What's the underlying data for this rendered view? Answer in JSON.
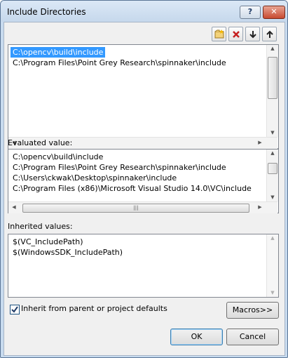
{
  "window": {
    "title": "Include Directories",
    "help_label": "?",
    "close_label": "✕"
  },
  "toolbar": {
    "new_line_icon": "new-line-icon",
    "delete_icon": "delete-icon",
    "move_down_icon": "arrow-down-icon",
    "move_up_icon": "arrow-up-icon"
  },
  "list": {
    "items": [
      "C:\\opencv\\build\\include",
      "C:\\Program Files\\Point Grey Research\\spinnaker\\include"
    ],
    "selected_index": 0
  },
  "evaluated": {
    "label": "Evaluated value:",
    "lines": [
      "C:\\opencv\\build\\include",
      "C:\\Program Files\\Point Grey Research\\spinnaker\\include",
      "C:\\Users\\ckwak\\Desktop\\spinnaker\\include",
      "C:\\Program Files (x86)\\Microsoft Visual Studio 14.0\\VC\\include"
    ]
  },
  "inherited": {
    "label": "Inherited values:",
    "lines": [
      "$(VC_IncludePath)",
      "$(WindowsSDK_IncludePath)"
    ]
  },
  "inherit_checkbox": {
    "label": "Inherit from parent or project defaults",
    "checked": true
  },
  "buttons": {
    "macros": "Macros>>",
    "ok": "OK",
    "cancel": "Cancel"
  }
}
